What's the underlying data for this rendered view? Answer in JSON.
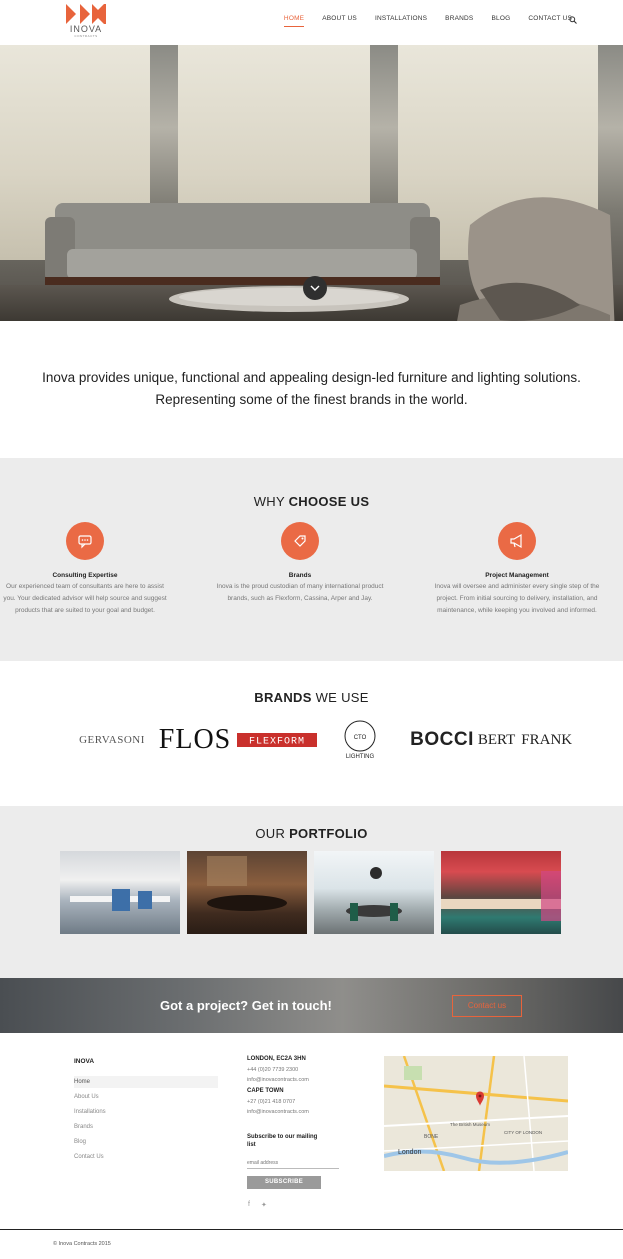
{
  "header": {
    "logo_text": "INOVA",
    "logo_sub": "CONTRACTS",
    "nav": [
      {
        "label": "HOME",
        "active": true
      },
      {
        "label": "ABOUT US",
        "active": false
      },
      {
        "label": "INSTALLATIONS",
        "active": false
      },
      {
        "label": "BRANDS",
        "active": false
      },
      {
        "label": "BLOG",
        "active": false
      },
      {
        "label": "CONTACT US",
        "active": false
      }
    ],
    "search_icon": "search-icon"
  },
  "intro": {
    "line1": "Inova provides unique, functional and appealing design-led furniture and lighting solutions.",
    "line2": "Representing some of the finest brands in the world."
  },
  "why": {
    "title_plain": "WHY ",
    "title_bold": "CHOOSE US",
    "features": [
      {
        "icon": "chat-icon",
        "title": "Consulting Expertise",
        "text": "Our experienced team of consultants are here to assist you. Your dedicated advisor will help source and suggest products that are suited to your goal and budget."
      },
      {
        "icon": "tag-icon",
        "title": "Brands",
        "text": "Inova is the proud custodian of many international product brands, such as Flexform, Cassina, Arper and Jay."
      },
      {
        "icon": "megaphone-icon",
        "title": "Project Management",
        "text": "Inova will oversee and administer every single step of the project. From initial sourcing to delivery, installation, and maintenance, while keeping you involved and informed."
      }
    ]
  },
  "brands": {
    "title_bold": "BRANDS",
    "title_plain": " WE USE",
    "items": [
      "GERVASONI",
      "FLOS",
      "FLEXFORM",
      "CTO",
      "LIGHTING",
      "BOCCI",
      "BERT",
      "FRANK"
    ]
  },
  "portfolio": {
    "title_plain": "OUR ",
    "title_bold": "PORTFOLIO"
  },
  "cta": {
    "text": "Got a project? Get in touch!",
    "button": "Contact us"
  },
  "footer": {
    "heading": "INOVA",
    "links": [
      "Home",
      "About Us",
      "Installations",
      "Brands",
      "Blog",
      "Contact Us"
    ],
    "london_title": "LONDON, EC2A 3HN",
    "london_phone": "+44 (0)20 7739 2300",
    "london_email": "info@inovacontracts.com",
    "capetown_title": "CAPE TOWN",
    "capetown_phone": "+27 (0)21 418 0707",
    "capetown_email": "info@inovacontracts.com",
    "subscribe_title_1": "Subscribe to our mailing",
    "subscribe_title_2": "list",
    "email_placeholder": "email address",
    "subscribe_button": "SUBSCRIBE",
    "social": [
      "facebook-icon",
      "twitter-icon"
    ],
    "map_labels": [
      "BONE",
      "London",
      "The British Museum",
      "CITY OF LONDON"
    ],
    "copyright": "© Inova Contracts 2015"
  },
  "colors": {
    "accent": "#e8643c",
    "section_bg": "#ececec"
  }
}
